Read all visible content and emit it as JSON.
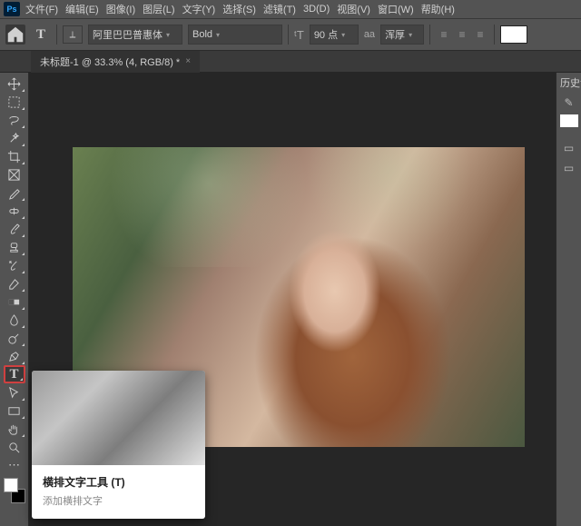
{
  "app_icon": "Ps",
  "menu": [
    "文件(F)",
    "编辑(E)",
    "图像(I)",
    "图层(L)",
    "文字(Y)",
    "选择(S)",
    "滤镜(T)",
    "3D(D)",
    "视图(V)",
    "窗口(W)",
    "帮助(H)"
  ],
  "options": {
    "font_family": "阿里巴巴普惠体",
    "font_weight": "Bold",
    "font_size": "90 点",
    "aa_label": "aa",
    "aa_value": "浑厚"
  },
  "tab": {
    "title": "未标题-1 @ 33.3% (4, RGB/8) *"
  },
  "right_panel": {
    "tab": "历史记"
  },
  "tooltip": {
    "title": "横排文字工具 (T)",
    "desc": "添加横排文字"
  },
  "colors": {
    "fg": "#ffffff",
    "bg": "#000000",
    "swatch": "#ffffff"
  }
}
